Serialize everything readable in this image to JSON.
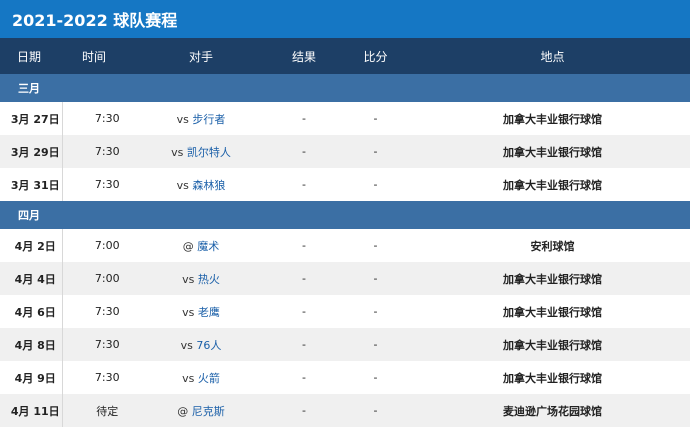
{
  "title": "2021-2022 球队赛程",
  "headers": {
    "date": "日期",
    "time": "时间",
    "opponent": "对手",
    "result": "结果",
    "score": "比分",
    "venue": "地点"
  },
  "months": [
    {
      "label": "三月",
      "games": [
        {
          "date": "3月 27日",
          "time": "7:30",
          "prefix": "vs",
          "team": "步行者",
          "result": "-",
          "score": "-",
          "venue": "加拿大丰业银行球馆"
        },
        {
          "date": "3月 29日",
          "time": "7:30",
          "prefix": "vs",
          "team": "凯尔特人",
          "result": "-",
          "score": "-",
          "venue": "加拿大丰业银行球馆"
        },
        {
          "date": "3月 31日",
          "time": "7:30",
          "prefix": "vs",
          "team": "森林狼",
          "result": "-",
          "score": "-",
          "venue": "加拿大丰业银行球馆"
        }
      ]
    },
    {
      "label": "四月",
      "games": [
        {
          "date": "4月 2日",
          "time": "7:00",
          "prefix": "@",
          "team": "魔术",
          "result": "-",
          "score": "-",
          "venue": "安利球馆"
        },
        {
          "date": "4月 4日",
          "time": "7:00",
          "prefix": "vs",
          "team": "热火",
          "result": "-",
          "score": "-",
          "venue": "加拿大丰业银行球馆"
        },
        {
          "date": "4月 6日",
          "time": "7:30",
          "prefix": "vs",
          "team": "老鹰",
          "result": "-",
          "score": "-",
          "venue": "加拿大丰业银行球馆"
        },
        {
          "date": "4月 8日",
          "time": "7:30",
          "prefix": "vs",
          "team": "76人",
          "result": "-",
          "score": "-",
          "venue": "加拿大丰业银行球馆"
        },
        {
          "date": "4月 9日",
          "time": "7:30",
          "prefix": "vs",
          "team": "火箭",
          "result": "-",
          "score": "-",
          "venue": "加拿大丰业银行球馆"
        },
        {
          "date": "4月 11日",
          "time": "待定",
          "prefix": "@",
          "team": "尼克斯",
          "result": "-",
          "score": "-",
          "venue": "麦迪逊广场花园球馆"
        }
      ]
    }
  ]
}
